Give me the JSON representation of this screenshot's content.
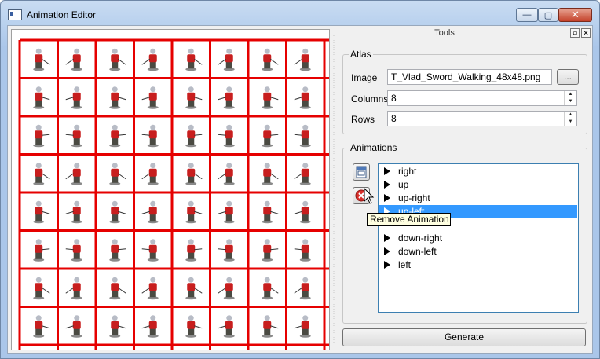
{
  "window": {
    "title": "Animation Editor",
    "controls": {
      "minimize": "—",
      "maximize": "▢",
      "close": "✕"
    }
  },
  "dock": {
    "title": "Tools",
    "float_icon": "float-icon",
    "close_icon": "close-icon"
  },
  "atlas": {
    "group_title": "Atlas",
    "image_label": "Image",
    "image_value": "T_Vlad_Sword_Walking_48x48.png",
    "browse_label": "...",
    "columns_label": "Columns",
    "columns_value": "8",
    "rows_label": "Rows",
    "rows_value": "8",
    "grid_color": "#e60000",
    "grid": {
      "columns": 8,
      "rows": 8
    }
  },
  "animations": {
    "group_title": "Animations",
    "add_icon": "add-animation-icon",
    "remove_icon": "remove-animation-icon",
    "items": [
      {
        "label": "right",
        "selected": false
      },
      {
        "label": "up",
        "selected": false
      },
      {
        "label": "up-right",
        "selected": false
      },
      {
        "label": "up-left",
        "selected": true
      },
      {
        "label": "",
        "selected": false
      },
      {
        "label": "down-right",
        "selected": false
      },
      {
        "label": "down-left",
        "selected": false
      },
      {
        "label": "left",
        "selected": false
      }
    ],
    "selection_color": "#3399ff"
  },
  "tooltip": {
    "text": "Remove Animation"
  },
  "generate": {
    "label": "Generate"
  }
}
